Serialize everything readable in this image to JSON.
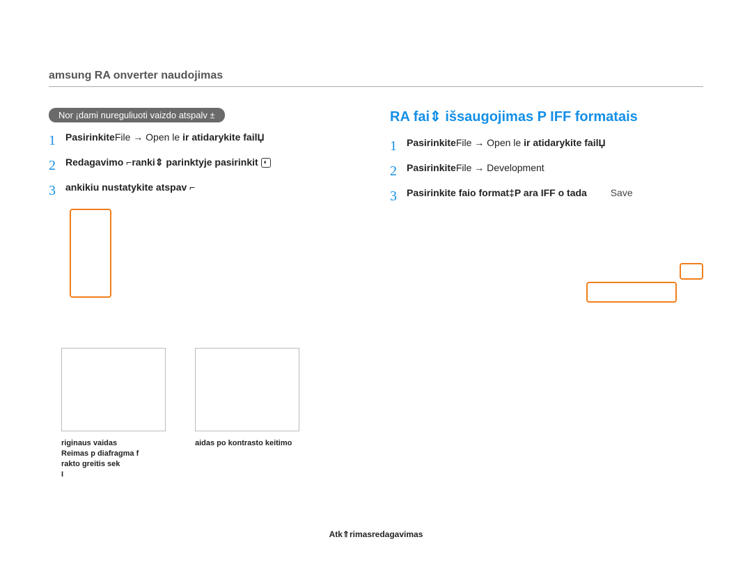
{
  "header_title": "amsung RA  onverter naudojimas",
  "left": {
    "pill": "Nor ¡dami nureguliuoti vaizdo atspalv    ±",
    "step1_strong_a": "Pasirinkite",
    "step1_light": "File → Open   le ",
    "step1_strong_b": "ir atidarykite failЏ",
    "step2": "Redagavimo ⌐ranki⇕ parinktyje pasirinkit",
    "step3": "ankikiu nustatykite atspav ⌐"
  },
  "right": {
    "section_title": "RA  fai⇕    išsaugojimas P IFF formatais",
    "step1_strong_a": "Pasirinkite",
    "step1_light": "File → Open   le ",
    "step1_strong_b": "ir atidarykite failЏ",
    "step2_strong": "Pasirinkite",
    "step2_light": "File → Development",
    "step3_strong": "Pasirinkite faio format‡P  ara IFF  o tada",
    "step3_save": "Save"
  },
  "captions": {
    "a_line1": "riginaus vaidas",
    "a_line2": "Reimas  p  diafragma f",
    "a_line3": "rakto greitis  sek",
    "a_line4": "I",
    "b": "aidas po kontrasto keitimo"
  },
  "footer": "Atk⇑rimasredagavimas"
}
